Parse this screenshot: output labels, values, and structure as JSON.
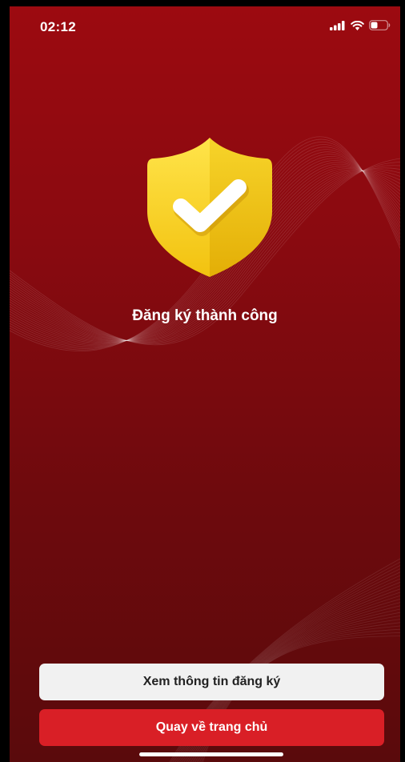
{
  "status_bar": {
    "time": "02:12",
    "icons": [
      "signal-icon",
      "wifi-icon",
      "battery-icon"
    ]
  },
  "result": {
    "icon": "shield-check-icon",
    "title": "Đăng ký thành công"
  },
  "actions": {
    "view_details_label": "Xem thông tin đăng ký",
    "back_home_label": "Quay về trang chủ"
  },
  "colors": {
    "background_top": "#9c0a10",
    "background_bottom": "#5a0a0c",
    "shield_yellow": "#f6d31f",
    "primary_button": "#d91f26",
    "secondary_button": "#f1f1f1"
  }
}
